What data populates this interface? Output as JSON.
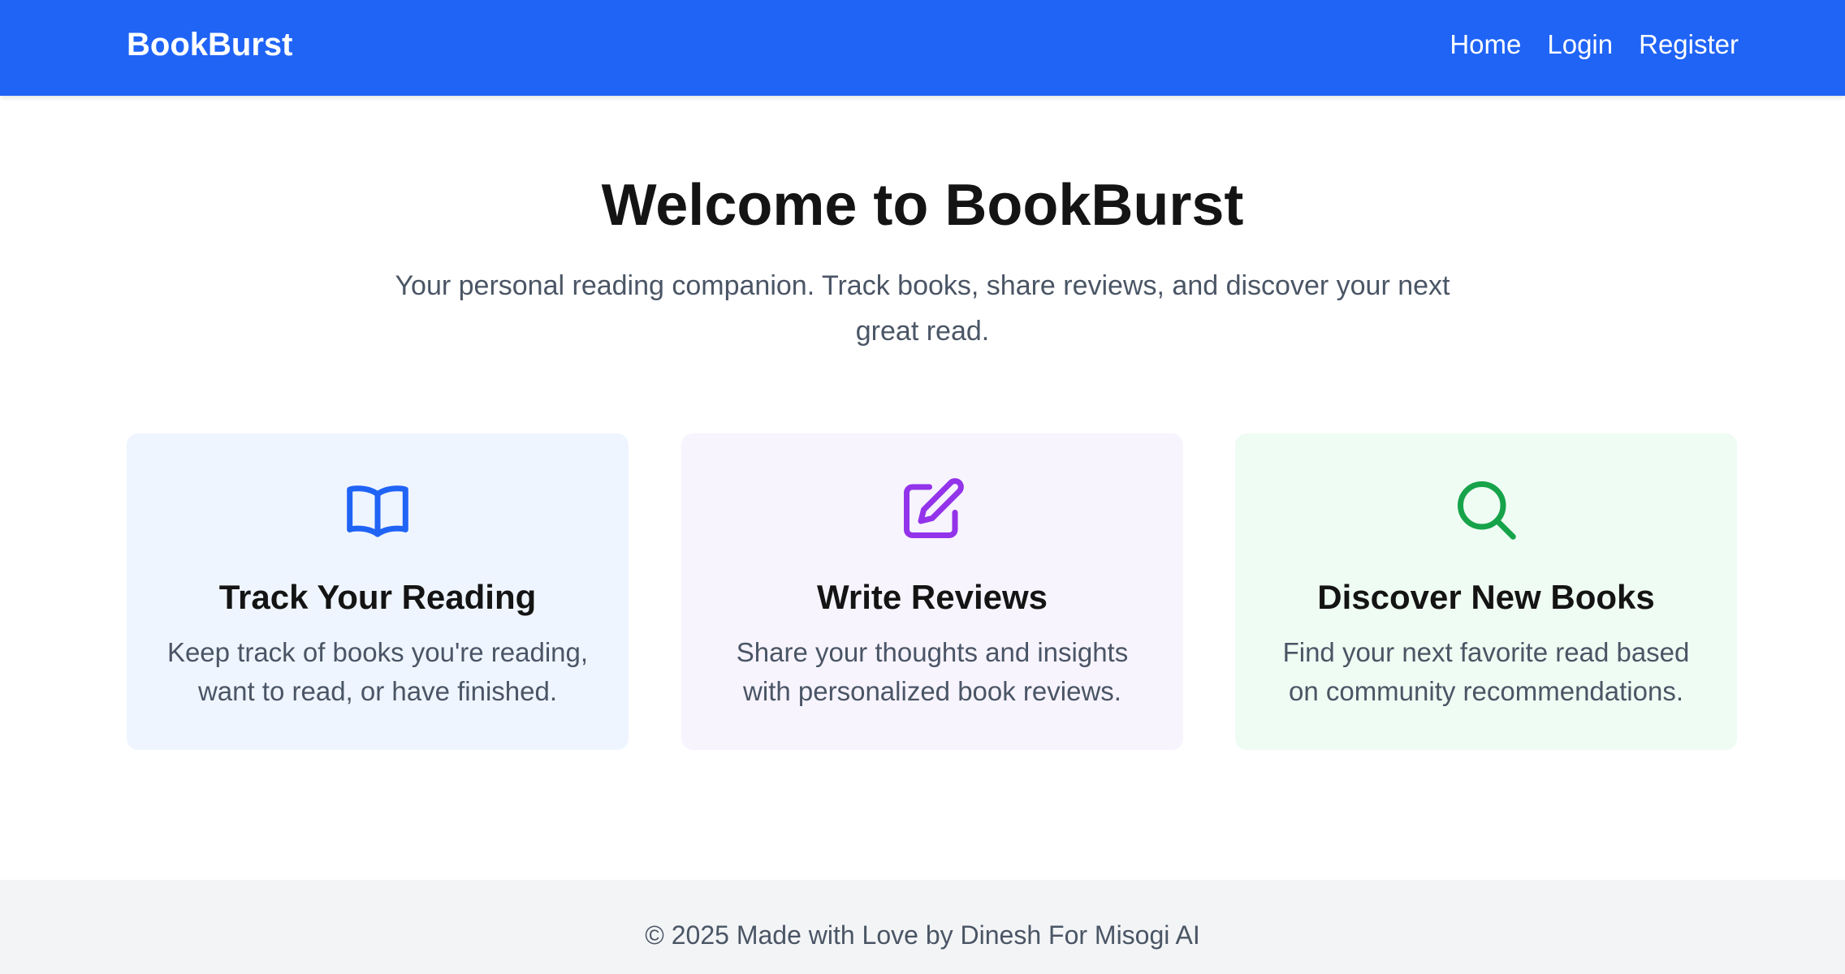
{
  "navbar": {
    "brand": "BookBurst",
    "links": [
      {
        "label": "Home"
      },
      {
        "label": "Login"
      },
      {
        "label": "Register"
      }
    ],
    "background_color": "#2064f6"
  },
  "hero": {
    "title": "Welcome to BookBurst",
    "subtitle": "Your personal reading companion. Track books, share reviews, and discover your next great read."
  },
  "features": [
    {
      "icon": "open-book-icon",
      "icon_color": "#2064f6",
      "background_color": "#eff5ff",
      "title": "Track Your Reading",
      "description": "Keep track of books you're reading, want to read, or have finished."
    },
    {
      "icon": "edit-pencil-icon",
      "icon_color": "#9333ea",
      "background_color": "#f7f4fe",
      "title": "Write Reviews",
      "description": "Share your thoughts and insights with personalized book reviews."
    },
    {
      "icon": "search-icon",
      "icon_color": "#16a34a",
      "background_color": "#effcf3",
      "title": "Discover New Books",
      "description": "Find your next favorite read based on community recommendations."
    }
  ],
  "footer": {
    "text": "© 2025 Made with Love by Dinesh For Misogi AI"
  }
}
